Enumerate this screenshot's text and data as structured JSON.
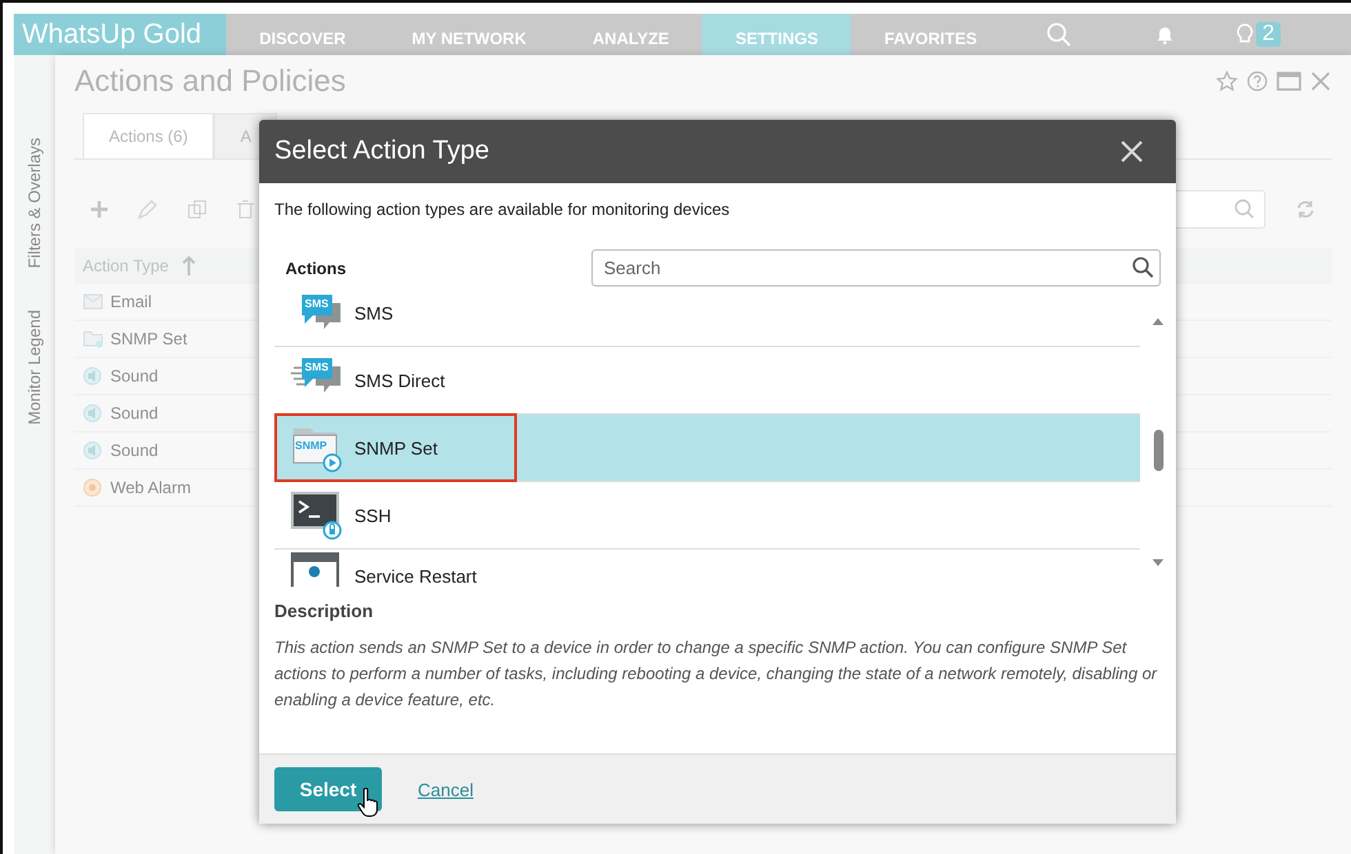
{
  "app": {
    "logo": "WhatsUp Gold",
    "nav": [
      {
        "label": "DISCOVER",
        "selected": false
      },
      {
        "label": "MY NETWORK",
        "selected": false
      },
      {
        "label": "ANALYZE",
        "selected": false
      },
      {
        "label": "SETTINGS",
        "selected": true
      },
      {
        "label": "FAVORITES",
        "selected": false
      }
    ],
    "notification_count": "2"
  },
  "side_tabs": [
    "Monitor Legend",
    "Filters & Overlays"
  ],
  "panel": {
    "title": "Actions and Policies",
    "tabs": [
      {
        "label": "Actions (6)",
        "selected": true
      },
      {
        "label": "A",
        "selected": false
      }
    ],
    "table": {
      "columns": [
        "Action Type"
      ],
      "rows": [
        {
          "kind": "email",
          "name": "Email"
        },
        {
          "kind": "snmp",
          "name": "SNMP Set"
        },
        {
          "kind": "sound",
          "name": "Sound"
        },
        {
          "kind": "sound",
          "name": "Sound"
        },
        {
          "kind": "sound",
          "name": "Sound"
        },
        {
          "kind": "web",
          "name": "Web Alarm"
        }
      ]
    }
  },
  "dialog": {
    "title": "Select Action Type",
    "intro": "The following action types are available for monitoring devices",
    "list_label": "Actions",
    "search": {
      "placeholder": "Search"
    },
    "items": [
      {
        "kind": "sms",
        "badge": "SMS",
        "name": "SMS",
        "selected": false,
        "highlighted": false
      },
      {
        "kind": "sms-direct",
        "badge": "SMS",
        "name": "SMS Direct",
        "selected": false,
        "highlighted": false
      },
      {
        "kind": "snmp",
        "badge": "SNMP",
        "name": "SNMP Set",
        "selected": true,
        "highlighted": true
      },
      {
        "kind": "ssh",
        "name": "SSH",
        "selected": false,
        "highlighted": false
      },
      {
        "kind": "service",
        "name": "Service Restart",
        "selected": false,
        "highlighted": false
      }
    ],
    "description_label": "Description",
    "description": "This action sends an SNMP Set to a device in order to change a specific SNMP action. You can configure SNMP Set actions to perform a number of tasks, including rebooting a device, changing the state of a network remotely, disabling or enabling a device feature, etc.",
    "buttons": {
      "primary": "Select",
      "secondary": "Cancel"
    }
  }
}
